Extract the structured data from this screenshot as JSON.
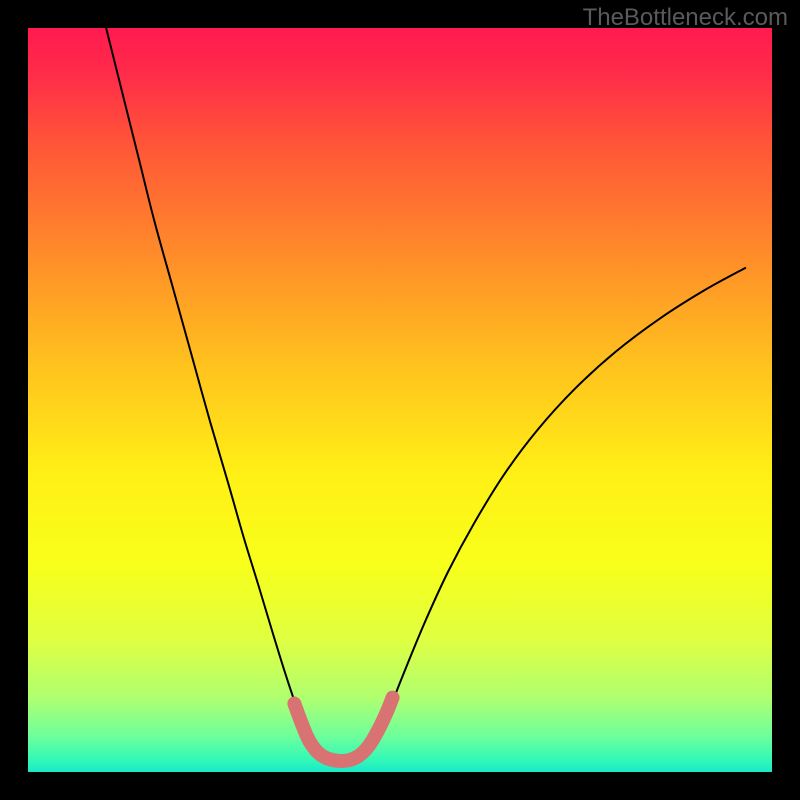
{
  "watermark": "TheBottleneck.com",
  "chart_data": {
    "type": "line",
    "title": "",
    "xlabel": "",
    "ylabel": "",
    "xlim": [
      0,
      100
    ],
    "ylim": [
      0,
      100
    ],
    "background_gradient": {
      "stops": [
        {
          "offset": 0.0,
          "color": "#ff1a50"
        },
        {
          "offset": 0.06,
          "color": "#ff2b4a"
        },
        {
          "offset": 0.15,
          "color": "#ff5338"
        },
        {
          "offset": 0.3,
          "color": "#ff8a2a"
        },
        {
          "offset": 0.45,
          "color": "#ffc11e"
        },
        {
          "offset": 0.6,
          "color": "#fff016"
        },
        {
          "offset": 0.72,
          "color": "#f8ff1a"
        },
        {
          "offset": 0.82,
          "color": "#e0ff40"
        },
        {
          "offset": 0.9,
          "color": "#b0ff70"
        },
        {
          "offset": 0.95,
          "color": "#70ff9a"
        },
        {
          "offset": 0.985,
          "color": "#30f8b8"
        },
        {
          "offset": 1.0,
          "color": "#18e8c8"
        }
      ]
    },
    "frame": {
      "x": 3.5,
      "y": 3.5,
      "width": 93,
      "height": 93,
      "stroke": "#000000",
      "stroke_width_px": 28
    },
    "series": [
      {
        "name": "left-curve",
        "stroke": "#000000",
        "stroke_width_px": 2,
        "points": [
          {
            "x": 10.5,
            "y": 100.0
          },
          {
            "x": 11.5,
            "y": 96.0
          },
          {
            "x": 13.0,
            "y": 90.0
          },
          {
            "x": 15.0,
            "y": 82.0
          },
          {
            "x": 17.0,
            "y": 74.0
          },
          {
            "x": 19.5,
            "y": 65.0
          },
          {
            "x": 22.0,
            "y": 56.0
          },
          {
            "x": 24.5,
            "y": 47.0
          },
          {
            "x": 27.0,
            "y": 38.5
          },
          {
            "x": 29.0,
            "y": 31.5
          },
          {
            "x": 31.0,
            "y": 25.0
          },
          {
            "x": 32.8,
            "y": 19.0
          },
          {
            "x": 34.5,
            "y": 13.5
          },
          {
            "x": 36.0,
            "y": 9.0
          },
          {
            "x": 37.2,
            "y": 5.8
          }
        ]
      },
      {
        "name": "right-curve",
        "stroke": "#000000",
        "stroke_width_px": 2,
        "points": [
          {
            "x": 47.5,
            "y": 5.8
          },
          {
            "x": 49.0,
            "y": 9.5
          },
          {
            "x": 51.0,
            "y": 14.5
          },
          {
            "x": 53.5,
            "y": 20.5
          },
          {
            "x": 56.5,
            "y": 27.0
          },
          {
            "x": 60.0,
            "y": 33.5
          },
          {
            "x": 64.0,
            "y": 40.0
          },
          {
            "x": 68.5,
            "y": 46.0
          },
          {
            "x": 73.5,
            "y": 51.5
          },
          {
            "x": 79.0,
            "y": 56.5
          },
          {
            "x": 85.0,
            "y": 61.0
          },
          {
            "x": 91.0,
            "y": 64.8
          },
          {
            "x": 96.5,
            "y": 67.8
          }
        ]
      },
      {
        "name": "valley-highlight",
        "stroke": "#d97272",
        "stroke_width_px": 14,
        "linecap": "round",
        "points": [
          {
            "x": 35.8,
            "y": 9.2
          },
          {
            "x": 36.8,
            "y": 6.5
          },
          {
            "x": 37.8,
            "y": 4.2
          },
          {
            "x": 39.0,
            "y": 2.6
          },
          {
            "x": 40.3,
            "y": 1.8
          },
          {
            "x": 41.8,
            "y": 1.5
          },
          {
            "x": 43.2,
            "y": 1.6
          },
          {
            "x": 44.5,
            "y": 2.2
          },
          {
            "x": 45.8,
            "y": 3.5
          },
          {
            "x": 47.0,
            "y": 5.5
          },
          {
            "x": 48.2,
            "y": 8.0
          },
          {
            "x": 49.0,
            "y": 10.0
          }
        ]
      }
    ]
  }
}
